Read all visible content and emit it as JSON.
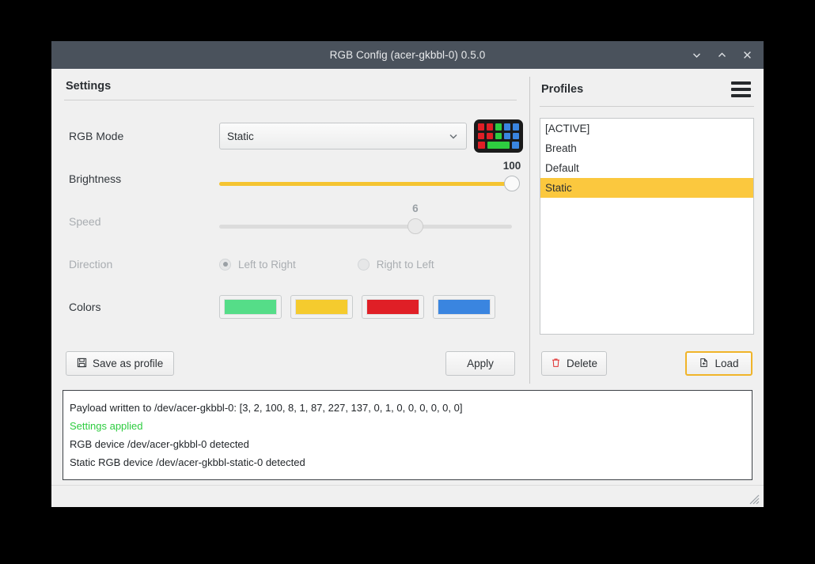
{
  "window": {
    "title": "RGB Config (acer-gkbbl-0) 0.5.0",
    "minimize_icon": "chevron-down-icon",
    "maximize_icon": "chevron-up-icon",
    "close_icon": "close-icon"
  },
  "settings": {
    "heading": "Settings",
    "rgb_mode": {
      "label": "RGB Mode",
      "value": "Static",
      "dropdown_icon": "chevron-down-icon",
      "preview_icon": "keyboard-icon"
    },
    "brightness": {
      "label": "Brightness",
      "value": "100",
      "percent": 100,
      "min": 0,
      "max": 100,
      "enabled": true
    },
    "speed": {
      "label": "Speed",
      "value": "6",
      "percent": 67,
      "min": 0,
      "max": 9,
      "enabled": false
    },
    "direction": {
      "label": "Direction",
      "enabled": false,
      "options": [
        {
          "label": "Left to Right",
          "selected": true
        },
        {
          "label": "Right to Left",
          "selected": false
        }
      ]
    },
    "colors": {
      "label": "Colors",
      "swatches": [
        {
          "name": "color-swatch-green",
          "hex": "#55dd88"
        },
        {
          "name": "color-swatch-yellow",
          "hex": "#f5cb2e"
        },
        {
          "name": "color-swatch-red",
          "hex": "#e01f26"
        },
        {
          "name": "color-swatch-blue",
          "hex": "#3a85e0"
        }
      ]
    },
    "save_button": {
      "label": "Save as profile",
      "icon": "floppy-disk-icon"
    },
    "apply_button": {
      "label": "Apply"
    }
  },
  "profiles": {
    "heading": "Profiles",
    "menu_icon": "hamburger-menu-icon",
    "items": [
      {
        "label": "[ACTIVE]",
        "selected": false
      },
      {
        "label": "Breath",
        "selected": false
      },
      {
        "label": "Default",
        "selected": false
      },
      {
        "label": "Static",
        "selected": true
      }
    ],
    "delete_button": {
      "label": "Delete",
      "icon": "trash-icon"
    },
    "load_button": {
      "label": "Load",
      "icon": "file-open-icon",
      "focused": true
    }
  },
  "log": {
    "lines": [
      {
        "text": "Payload written to /dev/acer-gkbbl-0: [3, 2, 100, 8, 1, 87, 227, 137, 0, 1, 0, 0, 0, 0, 0, 0]",
        "status": "normal"
      },
      {
        "text": "Settings applied",
        "status": "ok"
      },
      {
        "text": "RGB device /dev/acer-gkbbl-0 detected",
        "status": "normal"
      },
      {
        "text": "Static RGB device /dev/acer-gkbbl-static-0 detected",
        "status": "normal"
      }
    ]
  },
  "statusbar": {
    "resize_grip_icon": "resize-grip-icon"
  },
  "keyboard_icon_keys": [
    [
      "#e01f26",
      "#e01f26",
      "#2ecc40",
      "#3a85e0",
      "#3a85e0"
    ],
    [
      "#e01f26",
      "#e01f26",
      "#2ecc40",
      "#3a85e0",
      "#3a85e0"
    ],
    [
      "#e01f26",
      "#2ecc40",
      "#3a85e0"
    ]
  ],
  "theme": {
    "titlebar_bg": "#4a525c",
    "accent": "#f5c431",
    "selection": "#fbc83e",
    "ok_green": "#2ecc40"
  }
}
